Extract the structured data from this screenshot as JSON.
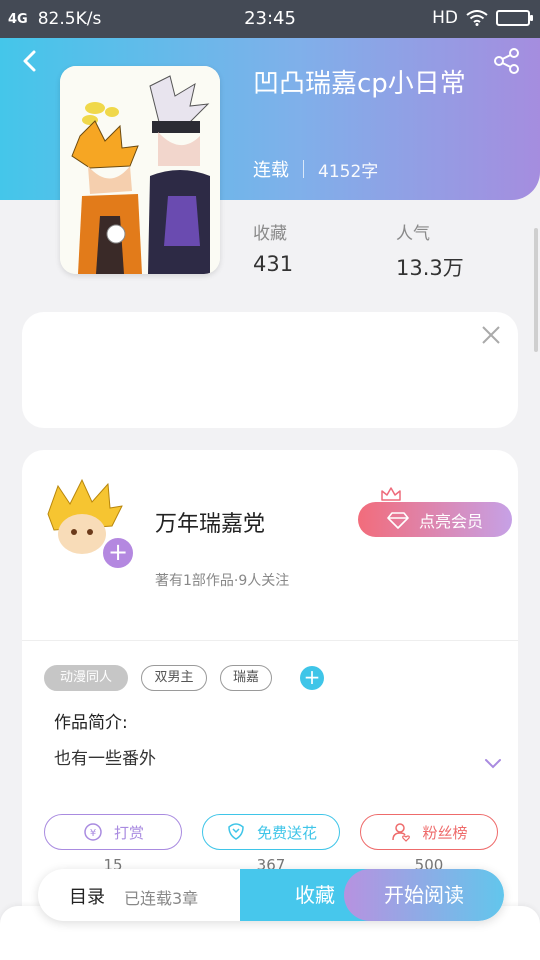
{
  "status_bar": {
    "network": "4G",
    "speed": "82.5K/s",
    "time": "23:45",
    "hd": "HD"
  },
  "book": {
    "title": "凹凸瑞嘉cp小日常",
    "status": "连载",
    "word_count": "4152字",
    "favorites_label": "收藏",
    "favorites_value": "431",
    "popularity_label": "人气",
    "popularity_value": "13.3万",
    "tags": [
      "动漫同人",
      "双男主",
      "瑞嘉"
    ],
    "intro_label": "作品简介:",
    "intro_text": "也有一些番外"
  },
  "author": {
    "name": "万年瑞嘉党",
    "summary": "著有1部作品·9人关注",
    "vip_label": "点亮会员"
  },
  "actions": [
    {
      "label": "打赏",
      "count": "15",
      "color": "#a98be0"
    },
    {
      "label": "免费送花",
      "count": "367",
      "color": "#3fc5e8"
    },
    {
      "label": "粉丝榜",
      "count": "500",
      "color": "#ee6b6b"
    }
  ],
  "bottom_bar": {
    "toc_label": "目录",
    "toc_sub": "已连载3章",
    "favorite_label": "收藏",
    "read_label": "开始阅读"
  },
  "icons": {
    "back": "back-arrow-icon",
    "share": "share-icon",
    "close": "close-icon",
    "expand": "chevron-down-icon"
  },
  "colors": {
    "header_gradient_start": "#44c6ea",
    "header_gradient_end": "#a58ddf",
    "accent_blue": "#47c7ec",
    "accent_purple": "#b488e0"
  }
}
